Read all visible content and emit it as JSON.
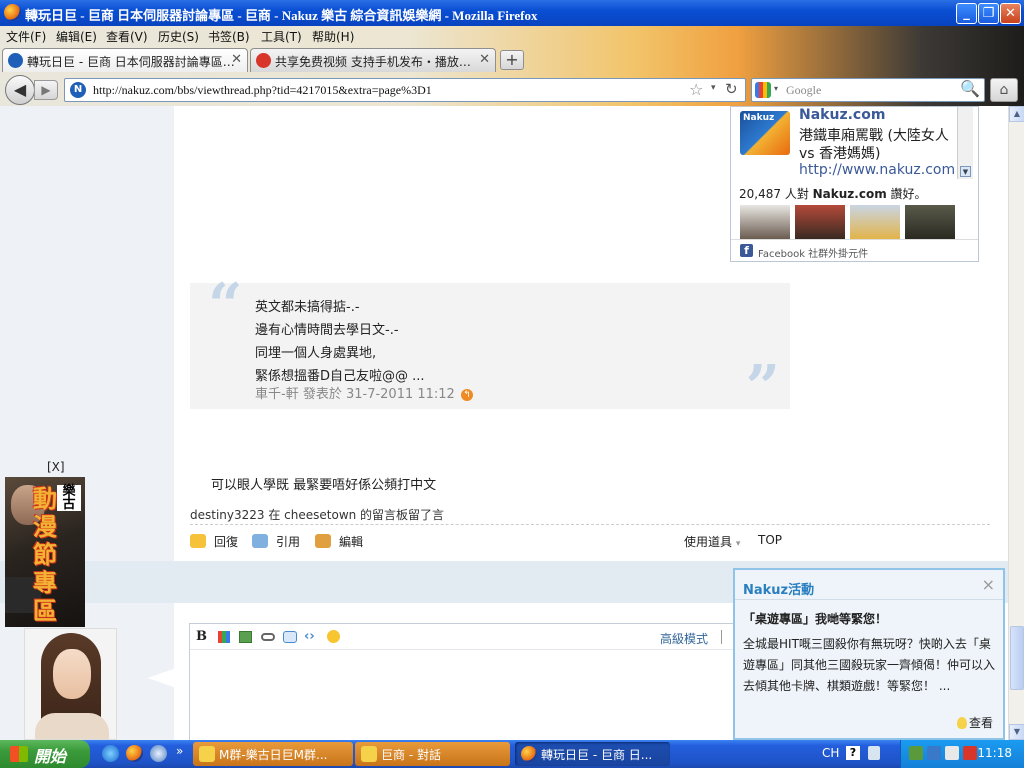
{
  "window": {
    "title": "轉玩日巨 - 巨商 日本伺服器討論專區 - 巨商 - Nakuz 樂古 綜合資訊娛樂網 - Mozilla Firefox",
    "min": "_",
    "max": "❐",
    "close": "✕"
  },
  "menu": [
    "文件(F)",
    "编辑(E)",
    "查看(V)",
    "历史(S)",
    "书签(B)",
    "工具(T)",
    "帮助(H)"
  ],
  "tabs": [
    {
      "label": "轉玩日巨 - 巨商 日本伺服器討論專區…",
      "close": "✕"
    },
    {
      "label": "共享免费视频   支持手机发布・播放…",
      "close": "✕"
    }
  ],
  "newtab": "+",
  "nav": {
    "back": "◀",
    "forward": "▶",
    "url": "http://nakuz.com/bbs/viewthread.php?tid=4217015&extra=page%3D1",
    "star": "☆",
    "dropdown": "▾",
    "reload": "↻",
    "search_placeholder": "Google",
    "search_drop": "▾",
    "search_go": "🔍",
    "home": "⌂"
  },
  "facebook": {
    "thumb_text": "Nakuz",
    "name": "Nakuz.com",
    "desc": "港鐵車廂罵戰 (大陸女人 vs 香港媽媽)",
    "url": "http://www.nakuz.com",
    "scroll_arrow": "▼",
    "count_num": "20,487",
    "count_text": " 人對 ",
    "count_name": "Nakuz.com",
    "count_end": " 讚好。",
    "footer_logo": "f",
    "footer": "Facebook 社群外掛元件"
  },
  "quote": {
    "open": "“",
    "close": "”",
    "lines": [
      "英文都未搞得掂-.-",
      "邊有心情時間去學日文-.-",
      "同埋一個人身處異地,",
      "緊係想搵番D自己友啦@@ ..."
    ],
    "meta": "車千-軒 發表於 31-7-2011 11:12",
    "back_icon": "↰"
  },
  "post": {
    "message": "可以眼人學既 最緊要唔好係公頻打中文",
    "signature": "destiny3223 在 cheesetown 的留言板留了言"
  },
  "actions": {
    "reply": "回復",
    "quote": "引用",
    "edit": "編輯",
    "tools": "使用道具",
    "tools_drop": "▾",
    "top": "TOP"
  },
  "editor": {
    "bold": "B",
    "advanced": "高級模式"
  },
  "float_ad": {
    "close": "[X]",
    "logo": "樂古",
    "text": "動漫節專區"
  },
  "notification": {
    "title": "Nakuz活動",
    "close": "×",
    "subtitle": "「桌遊專區」我哋等緊您！",
    "body": "全城最HIT嘅三國殺你有無玩呀？快啲入去「桌遊專區」同其他三國殺玩家一齊傾偈！仲可以入去傾其他卡牌、棋類遊戲！等緊您！ ...",
    "link": "查看"
  },
  "scrollbar": {
    "up": "▲",
    "down": "▼"
  },
  "taskbar": {
    "start": "開始",
    "more": "»",
    "tasks": [
      "M群-樂古日巨M群...",
      "巨商 - 對話",
      "轉玩日巨 - 巨商 日..."
    ],
    "lang": "CH",
    "help": "?",
    "clock": "11:18"
  },
  "colors": {
    "link_blue": "#3b5998",
    "accent_blue": "#2a7fc0",
    "taskbar_blue": "#245edc",
    "start_green": "#3a9a3a"
  }
}
